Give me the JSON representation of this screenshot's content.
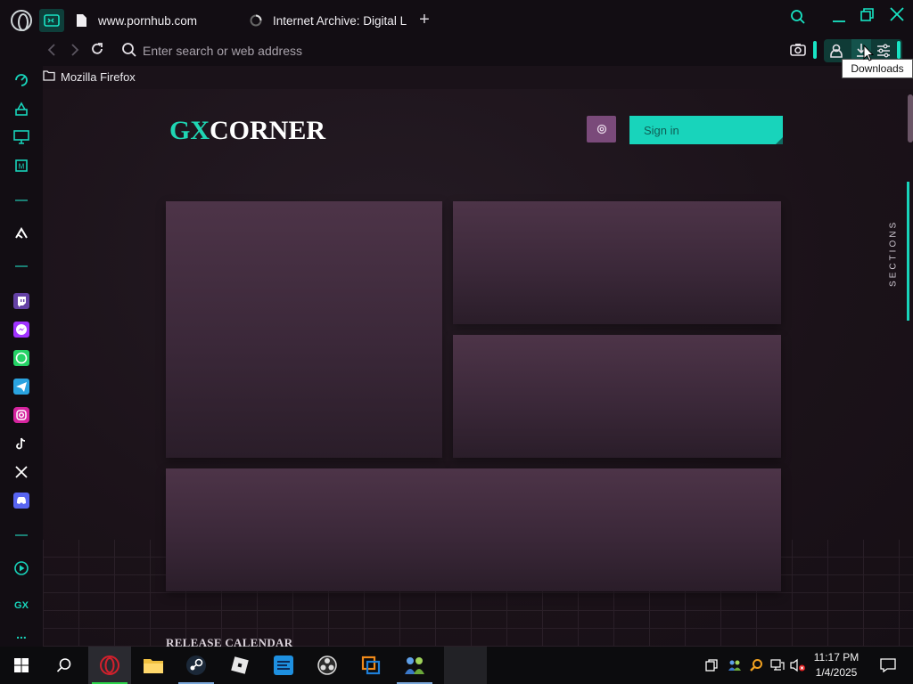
{
  "browser": {
    "tabs": [
      {
        "title": "www.pornhub.com"
      },
      {
        "title": "Internet Archive: Digital Lib"
      }
    ],
    "new_tab": "+",
    "address": {
      "placeholder": "Enter search or web address",
      "value": ""
    },
    "tooltip": "Downloads",
    "bookmarks": [
      {
        "label": "Mozilla Firefox"
      }
    ]
  },
  "page": {
    "logo_gx": "GX",
    "logo_corner": "CORNER",
    "signin_label": "Sign in",
    "sections_label": "SECTIONS",
    "release_calendar": "RELEASE CALENDAR"
  },
  "sidebar": {
    "icons": [
      "player-icon",
      "aria-icon",
      "display-icon",
      "memory-icon",
      "divider",
      "messenger-app-icon",
      "divider",
      "twitch-icon",
      "messenger-icon",
      "whatsapp-icon",
      "telegram-icon",
      "instagram-icon",
      "tiktok-icon",
      "x-icon",
      "discord-icon",
      "divider",
      "player-icon",
      "gx-label",
      "more-icon"
    ],
    "gx_label": "GX",
    "more_label": "..."
  },
  "taskbar": {
    "clock_time": "11:17 PM",
    "clock_date": "1/4/2025"
  },
  "colors": {
    "accent": "#18d4bb",
    "background": "#1a1219",
    "card": "#3b2839"
  }
}
